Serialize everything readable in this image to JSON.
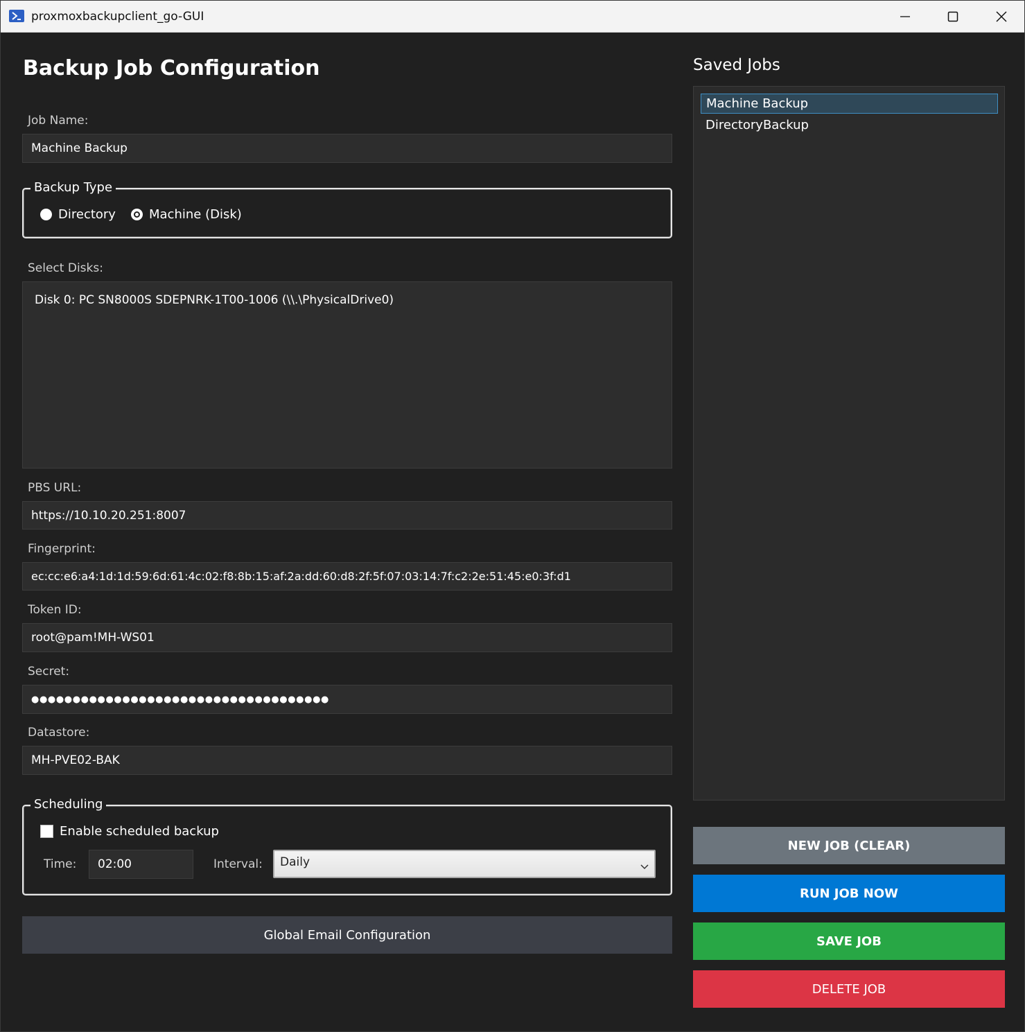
{
  "window": {
    "title": "proxmoxbackupclient_go-GUI"
  },
  "form": {
    "heading": "Backup Job Configuration",
    "job_name": {
      "label": "Job Name:",
      "value": "Machine Backup"
    },
    "backup_type": {
      "legend": "Backup Type",
      "options": [
        {
          "label": "Directory",
          "selected": false
        },
        {
          "label": "Machine (Disk)",
          "selected": true
        }
      ]
    },
    "disks": {
      "label": "Select Disks:",
      "items": [
        "Disk 0: PC SN8000S SDEPNRK-1T00-1006 (\\\\.\\PhysicalDrive0)"
      ]
    },
    "pbs_url": {
      "label": "PBS URL:",
      "value": "https://10.10.20.251:8007"
    },
    "fingerprint": {
      "label": "Fingerprint:",
      "value": "ec:cc:e6:a4:1d:1d:59:6d:61:4c:02:f8:8b:15:af:2a:dd:60:d8:2f:5f:07:03:14:7f:c2:2e:51:45:e0:3f:d1"
    },
    "token_id": {
      "label": "Token ID:",
      "value": "root@pam!MH-WS01"
    },
    "secret": {
      "label": "Secret:",
      "value": "●●●●●●●●●●●●●●●●●●●●●●●●●●●●●●●●●●●●"
    },
    "datastore": {
      "label": "Datastore:",
      "value": "MH-PVE02-BAK"
    },
    "scheduling": {
      "legend": "Scheduling",
      "enable_label": "Enable scheduled backup",
      "enabled": false,
      "time_label": "Time:",
      "time_value": "02:00",
      "interval_label": "Interval:",
      "interval_value": "Daily"
    },
    "email_button": "Global Email Configuration"
  },
  "saved_jobs": {
    "title": "Saved Jobs",
    "items": [
      "Machine Backup",
      "DirectoryBackup"
    ],
    "selected_index": 0
  },
  "actions": {
    "new": "NEW JOB (CLEAR)",
    "run": "RUN JOB NOW",
    "save": "SAVE JOB",
    "delete": "DELETE JOB"
  },
  "colors": {
    "background": "#202020",
    "input_bg": "#2d2d2d",
    "new_btn": "#6c757d",
    "run_btn": "#0078d4",
    "save_btn": "#28a745",
    "delete_btn": "#dc3545",
    "selection": "#3f8fc4"
  }
}
